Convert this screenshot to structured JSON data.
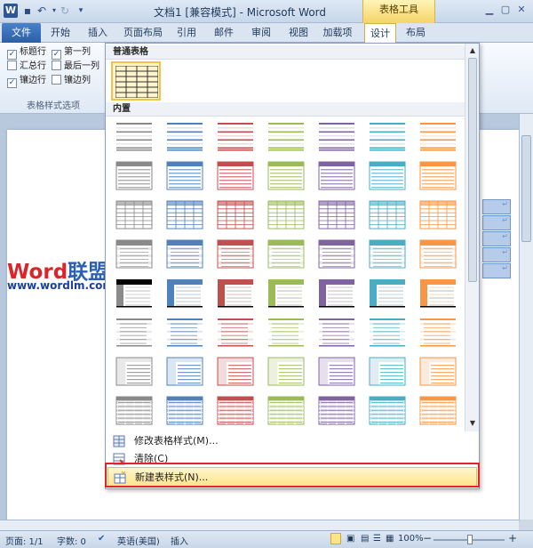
{
  "titlebar": {
    "title": "文档1 [兼容模式] - Microsoft Word",
    "logo": "W",
    "table_tools": "表格工具"
  },
  "tabs": [
    "文件",
    "开始",
    "插入",
    "页面布局",
    "引用",
    "邮件",
    "审阅",
    "视图",
    "加载项",
    "设计",
    "布局"
  ],
  "ribbon": {
    "options": [
      {
        "label": "标题行",
        "checked": true
      },
      {
        "label": "汇总行",
        "checked": false
      },
      {
        "label": "镶边行",
        "checked": true
      },
      {
        "label": "第一列",
        "checked": true
      },
      {
        "label": "最后一列",
        "checked": false
      },
      {
        "label": "镶边列",
        "checked": false
      }
    ],
    "group_label": "表格样式选项"
  },
  "gallery": {
    "plain_header": "普通表格",
    "builtin_header": "内置",
    "colors": [
      "#8a8a8a",
      "#4f81bd",
      "#c0504d",
      "#9bbb59",
      "#8064a2",
      "#4bacc6",
      "#f79646"
    ],
    "menu": {
      "modify": "修改表格样式(M)...",
      "clear": "清除(C)",
      "new": "新建表样式(N)..."
    }
  },
  "watermark": {
    "word": "Word",
    "lianmeng": "联盟",
    "url": "www.wordlm.com"
  },
  "status": {
    "page": "页面: 1/1",
    "words": "字数: 0",
    "language": "英语(美国)",
    "mode": "插入",
    "zoom": "100%",
    "minus": "−",
    "plus": "+"
  }
}
